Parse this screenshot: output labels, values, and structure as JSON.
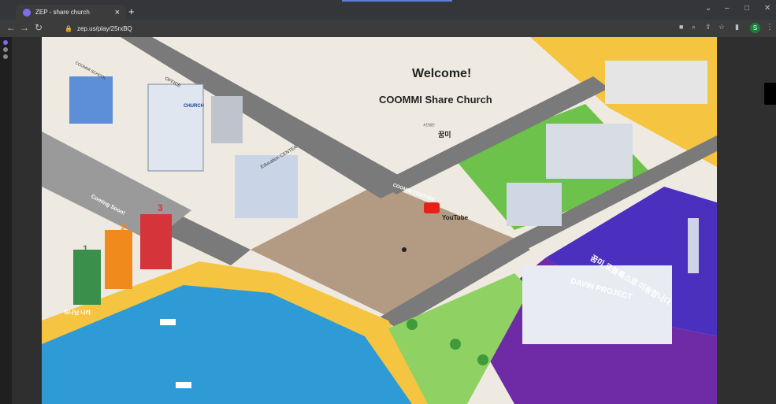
{
  "browser": {
    "tab_title": "ZEP - share church",
    "tab_close": "×",
    "new_tab": "+",
    "url": "zep.us/play/25rxBQ",
    "profile_initial": "S",
    "window_controls": [
      "⌄",
      "–",
      "□",
      "✕"
    ]
  },
  "map": {
    "welcome": "Welcome!",
    "subtitle": "COOMMI Share Church",
    "logo_text": "꿈미",
    "logo_small": "사단법인",
    "labels": {
      "church": "CHURCH",
      "school": "COOMMI SCHOOL",
      "office": "OFFICE",
      "education": "Education CENTER",
      "coming_soon": "Coming Soon!",
      "youtube_sign": "COOMMI YOUTUBE",
      "youtube": "YouTube",
      "davin": "DAVIN PROJECT",
      "heaven": "하나님 나라",
      "metaverse_kr": "꿈미 로블록스로 이동합니다",
      "num1": "1",
      "num2": "2",
      "num3": "3"
    }
  },
  "colors": {
    "sea": "#2e9bd6",
    "sand": "#f5c441",
    "grass": "#6cc24a",
    "road": "#7a7a7a",
    "plaza": "#b39a82",
    "cyber": "#4b2fbf"
  }
}
